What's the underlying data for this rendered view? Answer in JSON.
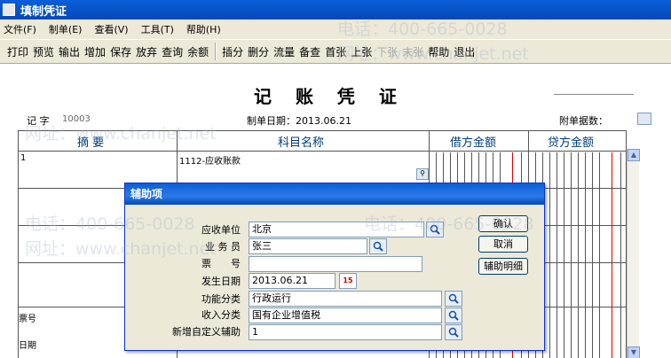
{
  "window": {
    "title": "填制凭证"
  },
  "menu": [
    "文件(F)",
    "制单(E)",
    "查看(V)",
    "工具(T)",
    "帮助(H)"
  ],
  "toolbar": {
    "group1": [
      "打印",
      "预览",
      "输出",
      "增加",
      "保存",
      "放弃",
      "查询",
      "余额"
    ],
    "group2": [
      "插分",
      "删分",
      "流量",
      "备查",
      "首张",
      "上张"
    ],
    "group2_disabled": [
      "下张",
      "末张"
    ],
    "group3": [
      "帮助",
      "退出"
    ]
  },
  "voucher": {
    "title": "记 账 凭 证",
    "type_label": "记 字",
    "number": "10003",
    "date_label": "制单日期：2013.06.21",
    "attachment_label": "附单据数：",
    "columns": [
      "摘 要",
      "科目名称",
      "借方金额",
      "贷方金额"
    ],
    "row1_summary": "1",
    "row1_account": "1112-应收账款",
    "bottom_labels": [
      "票号",
      "日期"
    ]
  },
  "dialog": {
    "title": "辅助项",
    "fields": [
      {
        "label": "应收单位",
        "value": "北京"
      },
      {
        "label": "业 务 员",
        "value": "张三"
      },
      {
        "label": "票　　号",
        "value": ""
      },
      {
        "label": "发生日期",
        "value": "2013.06.21"
      },
      {
        "label": "功能分类",
        "value": "行政运行"
      },
      {
        "label": "收入分类",
        "value": "国有企业增值税"
      },
      {
        "label": "新增自定义辅助",
        "value": "1"
      }
    ],
    "buttons": [
      "确认",
      "取消",
      "辅助明细"
    ]
  },
  "watermark": {
    "phone": "电话：400-665-0028",
    "site": "网址：www.chanjet.net"
  }
}
